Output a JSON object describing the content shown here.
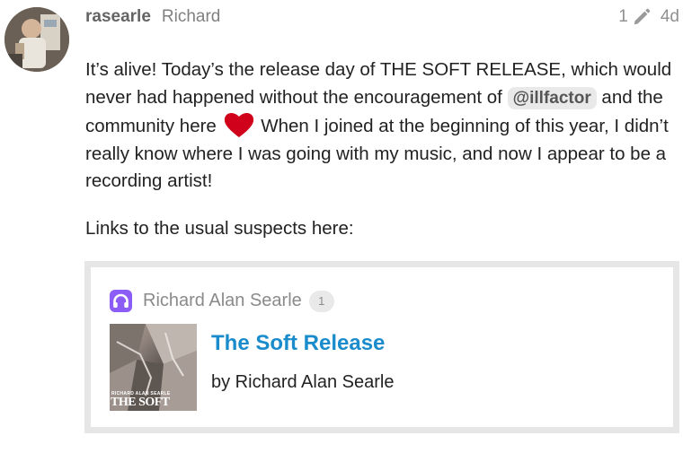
{
  "post": {
    "username": "rasearle",
    "full_name": "Richard",
    "edit_count": "1",
    "age": "4d",
    "paragraph_1": {
      "text_a": "It’s alive! Today’s the release day of THE SOFT RELEASE, which would never had happened without the encouragement of ",
      "mention": "@illfactor",
      "text_b": " and the community here ",
      "emoji": "heart-icon",
      "text_c": " When I joined at the beginning of this year, I didn’t really know where I was going with my music, and now I appear to be a recording artist!"
    },
    "paragraph_2": "Links to the usual suspects here:"
  },
  "onebox": {
    "source_name": "Richard Alan Searle",
    "click_count": "1",
    "title": "The Soft Release",
    "byline": "by Richard Alan Searle",
    "album_art_text_small": "RICHARD ALAN SEARLE",
    "album_art_text_big": "THE SOFT RELEASE"
  },
  "colors": {
    "link": "#1a8ccc",
    "heart": "#d0021b",
    "source_icon": "#8b5cf6",
    "onebox_border": "#e6e6e6"
  }
}
